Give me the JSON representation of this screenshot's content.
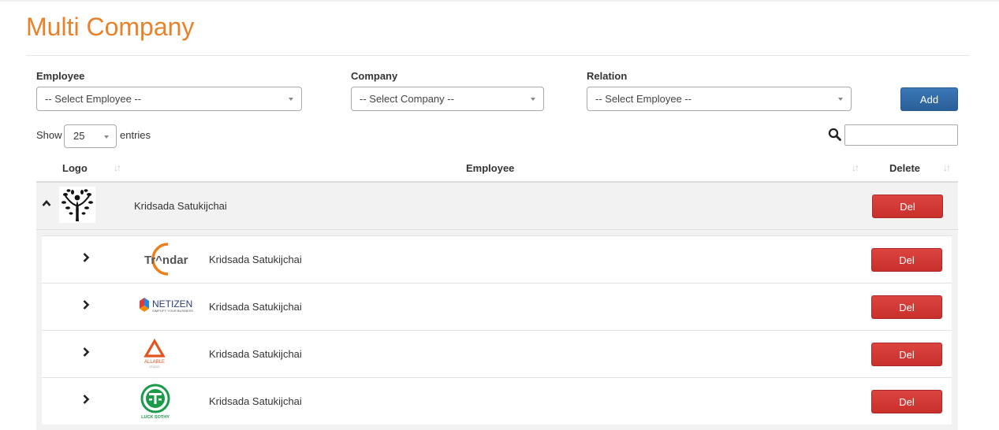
{
  "page": {
    "title": "Multi Company"
  },
  "filters": {
    "employee_label": "Employee",
    "employee_value": "-- Select Employee --",
    "company_label": "Company",
    "company_value": "-- Select Company --",
    "relation_label": "Relation",
    "relation_value": "-- Select Employee --",
    "add_label": "Add"
  },
  "length": {
    "show_label": "Show",
    "value": "25",
    "entries_label": "entries"
  },
  "search": {
    "icon": "search-icon",
    "value": ""
  },
  "table": {
    "headers": [
      "Logo",
      "Employee",
      "Delete"
    ],
    "parent": {
      "name": "Kridsada Satukijchai",
      "logo": "tree-person-logo",
      "del_label": "Del",
      "expanded": true
    },
    "children": [
      {
        "name": "Kridsada Satukijchai",
        "logo": "trandar-logo",
        "logo_text": "Tr^ndar",
        "del_label": "Del"
      },
      {
        "name": "Kridsada Satukijchai",
        "logo": "netizen-logo",
        "logo_text": "NETIZEN",
        "logo_subtext": "SIMPLIFY YOUR BUSINESS",
        "del_label": "Del"
      },
      {
        "name": "Kridsada Satukijchai",
        "logo": "allable-logo",
        "logo_text": "ALLABLE",
        "logo_subtext": "STUDIO",
        "del_label": "Del"
      },
      {
        "name": "Kridsada Satukijchai",
        "logo": "luck-sothy-logo",
        "logo_text": "LUCK SOTHY",
        "del_label": "Del"
      }
    ]
  },
  "colors": {
    "title": "#e8822a",
    "add_button": "#2f6ca8",
    "del_button": "#d2322d"
  }
}
